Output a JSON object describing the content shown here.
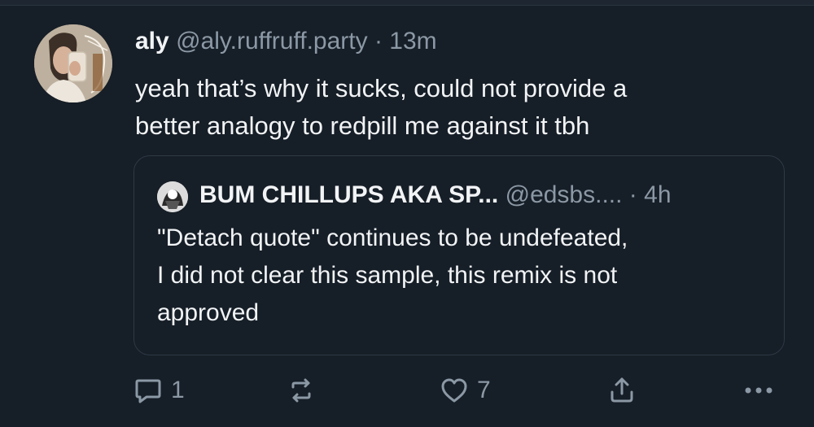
{
  "post": {
    "author_name": "aly",
    "handle": "@aly.ruffruff.party",
    "separator": " · ",
    "time": "13m",
    "text_line1": "yeah that’s why it sucks, could not provide a",
    "text_line2": "better analogy to redpill me against it tbh"
  },
  "quote": {
    "author_name": "BUM CHILLUPS AKA SP...",
    "handle": "@edsbs....",
    "separator": " · ",
    "time": "4h",
    "text_line1": "\"Detach quote\" continues to be undefeated,",
    "text_line2": "I did not clear this sample, this remix is not",
    "text_line3": "approved"
  },
  "actions": {
    "reply_count": "1",
    "like_count": "7"
  },
  "colors": {
    "background": "#161e27",
    "text": "#f1f3f5",
    "muted": "#8b98a5",
    "border": "#2e3a47"
  },
  "icons": [
    "reply-icon",
    "repost-icon",
    "heart-icon",
    "share-icon",
    "more-icon"
  ]
}
